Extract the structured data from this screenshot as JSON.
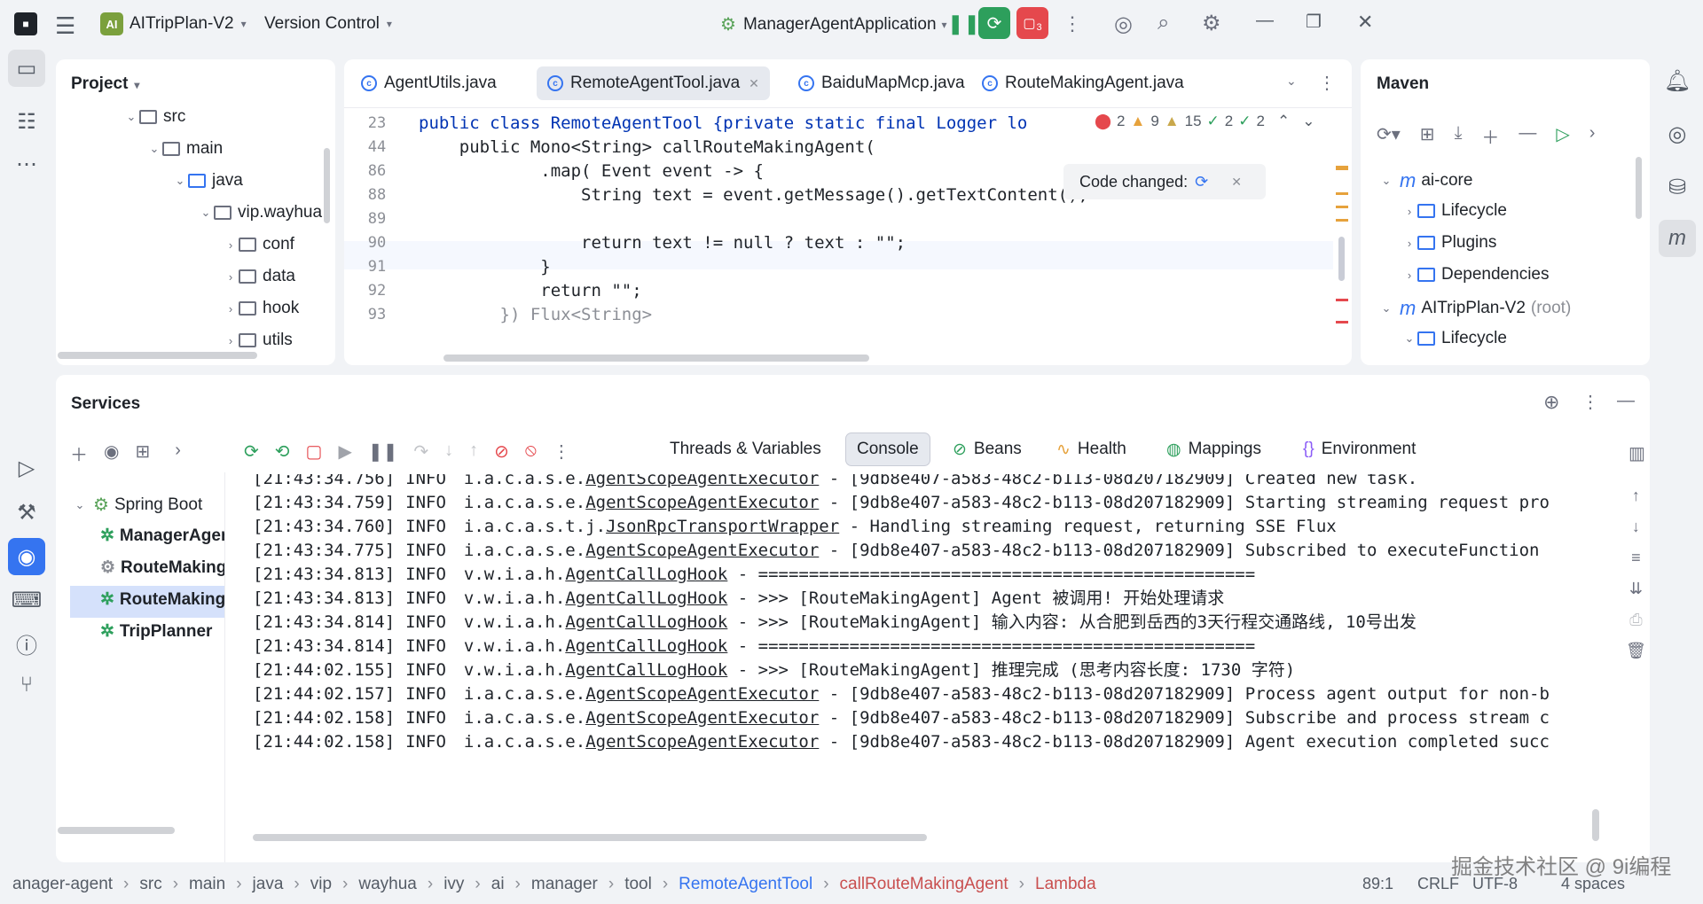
{
  "titlebar": {
    "project_badge": "AI",
    "project_name": "AITripPlan-V2",
    "vcs": "Version Control",
    "run_config": "ManagerAgentApplication",
    "notif_count": "3"
  },
  "project_panel": {
    "title": "Project",
    "tree": [
      {
        "label": "src"
      },
      {
        "label": "main"
      },
      {
        "label": "java"
      },
      {
        "label": "vip.wayhua"
      },
      {
        "label": "conf"
      },
      {
        "label": "data"
      },
      {
        "label": "hook"
      },
      {
        "label": "utils"
      }
    ]
  },
  "editor": {
    "tabs": [
      "AgentUtils.java",
      "RemoteAgentTool.java",
      "BaiduMapMcp.java",
      "RouteMakingAgent.java"
    ],
    "inspections": {
      "errors": "2",
      "warnings": "9",
      "weak": "15",
      "ok1": "2",
      "ok2": "2"
    },
    "code_changed": "Code changed:",
    "lines": [
      {
        "num": "23",
        "text": "public class RemoteAgentTool {private static final Logger lo"
      },
      {
        "num": "44",
        "text": "    public Mono<String> callRouteMakingAgent("
      },
      {
        "num": "86",
        "text": "            .map( Event event -> {"
      },
      {
        "num": "88",
        "text": "                String text = event.getMessage().getTextContent();"
      },
      {
        "num": "89",
        "text": ""
      },
      {
        "num": "90",
        "text": "                return text != null ? text : \"\";"
      },
      {
        "num": "91",
        "text": "            }"
      },
      {
        "num": "92",
        "text": "            return \"\";"
      },
      {
        "num": "93",
        "text": "        }) Flux<String>"
      }
    ]
  },
  "maven": {
    "title": "Maven",
    "tree": [
      {
        "label": "ai-core"
      },
      {
        "label": "Lifecycle"
      },
      {
        "label": "Plugins"
      },
      {
        "label": "Dependencies"
      },
      {
        "label": "AITripPlan-V2",
        "suffix": "(root)"
      },
      {
        "label": "Lifecycle"
      }
    ]
  },
  "services": {
    "title": "Services",
    "tabs": [
      "Threads & Variables",
      "Console",
      "Beans",
      "Health",
      "Mappings",
      "Environment"
    ],
    "tree": [
      {
        "label": "Spring Boot"
      },
      {
        "label": "ManagerAgent"
      },
      {
        "label": "RouteMakingAgent"
      },
      {
        "label": "RouteMakingAgent"
      },
      {
        "label": "TripPlanner"
      }
    ],
    "log": [
      {
        "ts": "[21:43:34.756]",
        "lvl": "INFO",
        "logger": "i.a.c.a.s.e.AgentScopeAgentExecutor",
        "msg": " - [9db8e407-a583-48c2-b113-08d207182909] Created new task."
      },
      {
        "ts": "[21:43:34.759]",
        "lvl": "INFO",
        "logger": "i.a.c.a.s.e.AgentScopeAgentExecutor",
        "msg": " - [9db8e407-a583-48c2-b113-08d207182909] Starting streaming request pro"
      },
      {
        "ts": "[21:43:34.760]",
        "lvl": "INFO",
        "logger": "i.a.c.a.s.t.j.JsonRpcTransportWrapper",
        "msg": " - Handling streaming request, returning SSE Flux"
      },
      {
        "ts": "[21:43:34.775]",
        "lvl": "INFO",
        "logger": "i.a.c.a.s.e.AgentScopeAgentExecutor",
        "msg": " - [9db8e407-a583-48c2-b113-08d207182909] Subscribed to executeFunction"
      },
      {
        "ts": "[21:43:34.813]",
        "lvl": "INFO",
        "logger": "v.w.i.a.h.AgentCallLogHook",
        "msg": " - ================================================="
      },
      {
        "ts": "[21:43:34.813]",
        "lvl": "INFO",
        "logger": "v.w.i.a.h.AgentCallLogHook",
        "msg": " - >>> [RouteMakingAgent] Agent 被调用! 开始处理请求"
      },
      {
        "ts": "[21:43:34.814]",
        "lvl": "INFO",
        "logger": "v.w.i.a.h.AgentCallLogHook",
        "msg": " - >>> [RouteMakingAgent] 输入内容: 从合肥到岳西的3天行程交通路线, 10号出发"
      },
      {
        "ts": "[21:43:34.814]",
        "lvl": "INFO",
        "logger": "v.w.i.a.h.AgentCallLogHook",
        "msg": " - ================================================="
      },
      {
        "ts": "[21:44:02.155]",
        "lvl": "INFO",
        "logger": "v.w.i.a.h.AgentCallLogHook",
        "msg": " - >>> [RouteMakingAgent] 推理完成 (思考内容长度: 1730 字符)"
      },
      {
        "ts": "[21:44:02.157]",
        "lvl": "INFO",
        "logger": "i.a.c.a.s.e.AgentScopeAgentExecutor",
        "msg": " - [9db8e407-a583-48c2-b113-08d207182909] Process agent output for non-b"
      },
      {
        "ts": "[21:44:02.158]",
        "lvl": "INFO",
        "logger": "i.a.c.a.s.e.AgentScopeAgentExecutor",
        "msg": " - [9db8e407-a583-48c2-b113-08d207182909] Subscribe and process stream c"
      },
      {
        "ts": "[21:44:02.158]",
        "lvl": "INFO",
        "logger": "i.a.c.a.s.e.AgentScopeAgentExecutor",
        "msg": " - [9db8e407-a583-48c2-b113-08d207182909] Agent execution completed succ"
      }
    ]
  },
  "breadcrumb": [
    "anager-agent",
    "src",
    "main",
    "java",
    "vip",
    "wayhua",
    "ivy",
    "ai",
    "manager",
    "tool",
    "RemoteAgentTool",
    "callRouteMakingAgent",
    "Lambda"
  ],
  "statusbar": {
    "pos": "89:1",
    "eol": "CRLF",
    "enc": "UTF-8",
    "indent": "4 spaces"
  },
  "watermark": "掘金技术社区 @ 9i编程",
  "colors": {
    "accent": "#3574f0",
    "run_green": "#2d9f5c",
    "stop_red": "#e5484d",
    "selection": "#d5e1fb"
  }
}
